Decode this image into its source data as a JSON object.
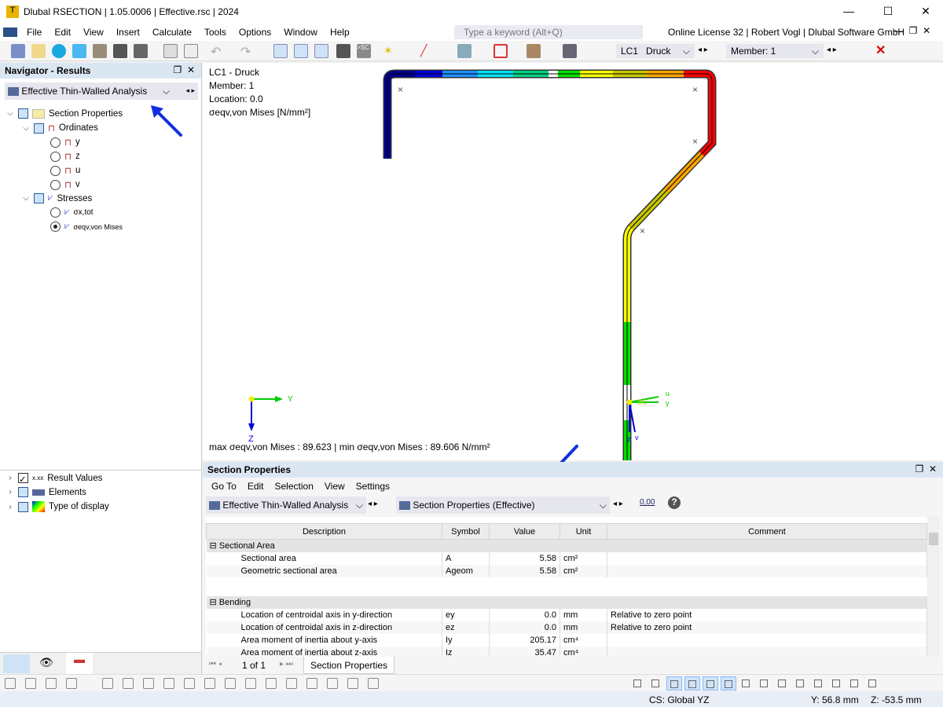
{
  "window": {
    "title": "Dlubal RSECTION | 1.05.0006 | Effective.rsc | 2024"
  },
  "menu": [
    "File",
    "Edit",
    "View",
    "Insert",
    "Calculate",
    "Tools",
    "Options",
    "Window",
    "Help"
  ],
  "search": {
    "placeholder": "Type a keyword (Alt+Q)"
  },
  "license": "Online License 32 | Robert Vogl | Dlubal Software GmbH",
  "toolbar": {
    "lc_badge": "G",
    "lc_id": "LC1",
    "lc_name": "Druck",
    "member": "Member: 1"
  },
  "navigator": {
    "title": "Navigator - Results",
    "analysis": "Effective Thin-Walled Analysis",
    "tree": {
      "section_properties": "Section Properties",
      "ordinates": "Ordinates",
      "ord_items": [
        "y",
        "z",
        "u",
        "v"
      ],
      "stresses": "Stresses",
      "sx": "σx,tot",
      "sv": "σeqv,von Mises"
    },
    "bottom_items": [
      "Result Values",
      "Elements",
      "Type of display"
    ]
  },
  "viewport": {
    "lc": "LC1 - Druck",
    "member": "Member: 1",
    "location": "Location: 0.0",
    "quantity": "σeqv,von Mises",
    "unit": "[N/mm²]",
    "summary": "max σeqv,von Mises : 89.623 | min σeqv,von Mises : 89.606 N/mm²",
    "axes": {
      "y": "Y",
      "z": "Z",
      "u": "u",
      "v": "v",
      "yl": "y",
      "zl": "z",
      "sc": "SC"
    },
    "colors": [
      "#00008b",
      "#0000dd",
      "#1e90ff",
      "#00e5ff",
      "#00d080",
      "#00e000",
      "#ffff00",
      "#c8c800",
      "#ffa500",
      "#ff0000"
    ]
  },
  "panel": {
    "title": "Section Properties",
    "menu": [
      "Go To",
      "Edit",
      "Selection",
      "View",
      "Settings"
    ],
    "analysis": "Effective Thin-Walled Analysis",
    "table_sel": "Section Properties (Effective)",
    "columns": [
      "Description",
      "Symbol",
      "Value",
      "Unit",
      "Comment"
    ],
    "groups": [
      {
        "name": "Sectional Area",
        "rows": [
          [
            "Sectional area",
            "A",
            "5.58",
            "cm²",
            ""
          ],
          [
            "Geometric sectional area",
            "Ageom",
            "5.58",
            "cm²",
            ""
          ]
        ]
      },
      {
        "name": "Bending",
        "rows": [
          [
            "Location of centroidal axis in y-direction",
            "ey",
            "0.0",
            "mm",
            "Relative to zero point"
          ],
          [
            "Location of centroidal axis in z-direction",
            "ez",
            "0.0",
            "mm",
            "Relative to zero point"
          ],
          [
            "Area moment of inertia about y-axis",
            "Iy",
            "205.17",
            "cm⁴",
            ""
          ],
          [
            "Area moment of inertia about z-axis",
            "Iz",
            "35.47",
            "cm⁴",
            ""
          ]
        ]
      }
    ],
    "pager": "1 of 1",
    "sheet_tab": "Section Properties"
  },
  "status": {
    "cs": "CS: Global YZ",
    "y": "Y: 56.8 mm",
    "z": "Z: -53.5 mm"
  }
}
